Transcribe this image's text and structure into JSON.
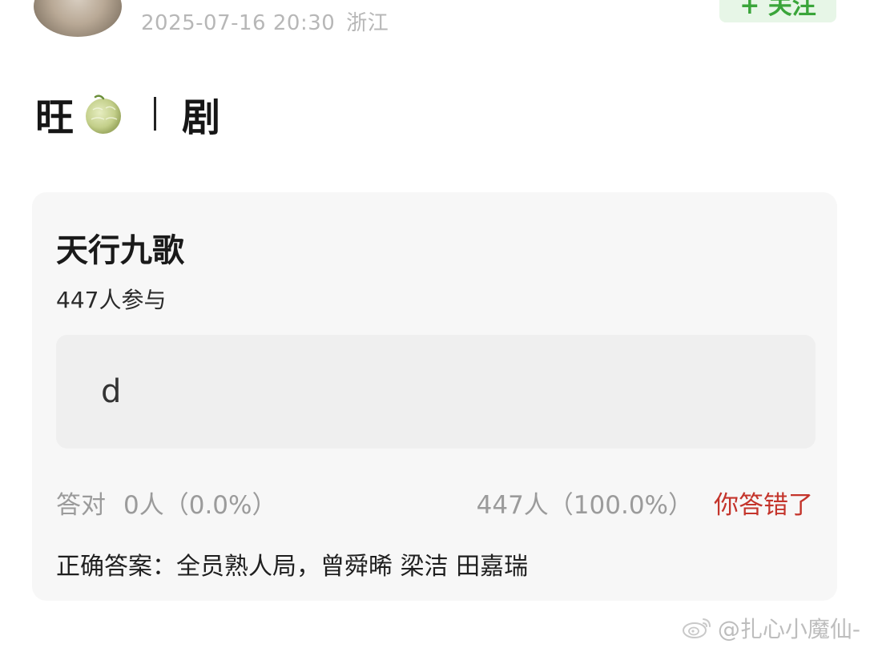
{
  "header": {
    "timestamp": "2025-07-16 20:30",
    "location": "浙江",
    "follow_label": "+ 关注"
  },
  "post": {
    "title_prefix": "旺",
    "title_suffix": "剧"
  },
  "quiz": {
    "title": "天行九歌",
    "participants": "447人参与",
    "option_text": "d",
    "correct_label": "答对",
    "correct_count": "0人（0.0%）",
    "wrong_count": "447人（100.0%）",
    "wrong_tag": "你答错了",
    "answer_text": "正确答案：全员熟人局，曾舜晞 梁洁 田嘉瑞"
  },
  "watermark": {
    "text": "@扎心小魔仙-"
  },
  "colors": {
    "follow_bg": "#e7f6e7",
    "follow_text": "#3aa53a",
    "wrong_red": "#c4342b",
    "card_bg": "#f7f7f7",
    "meta_gray": "#b7b7b7"
  },
  "icons": {
    "melon": "melon-icon",
    "weibo": "weibo-logo-icon"
  }
}
